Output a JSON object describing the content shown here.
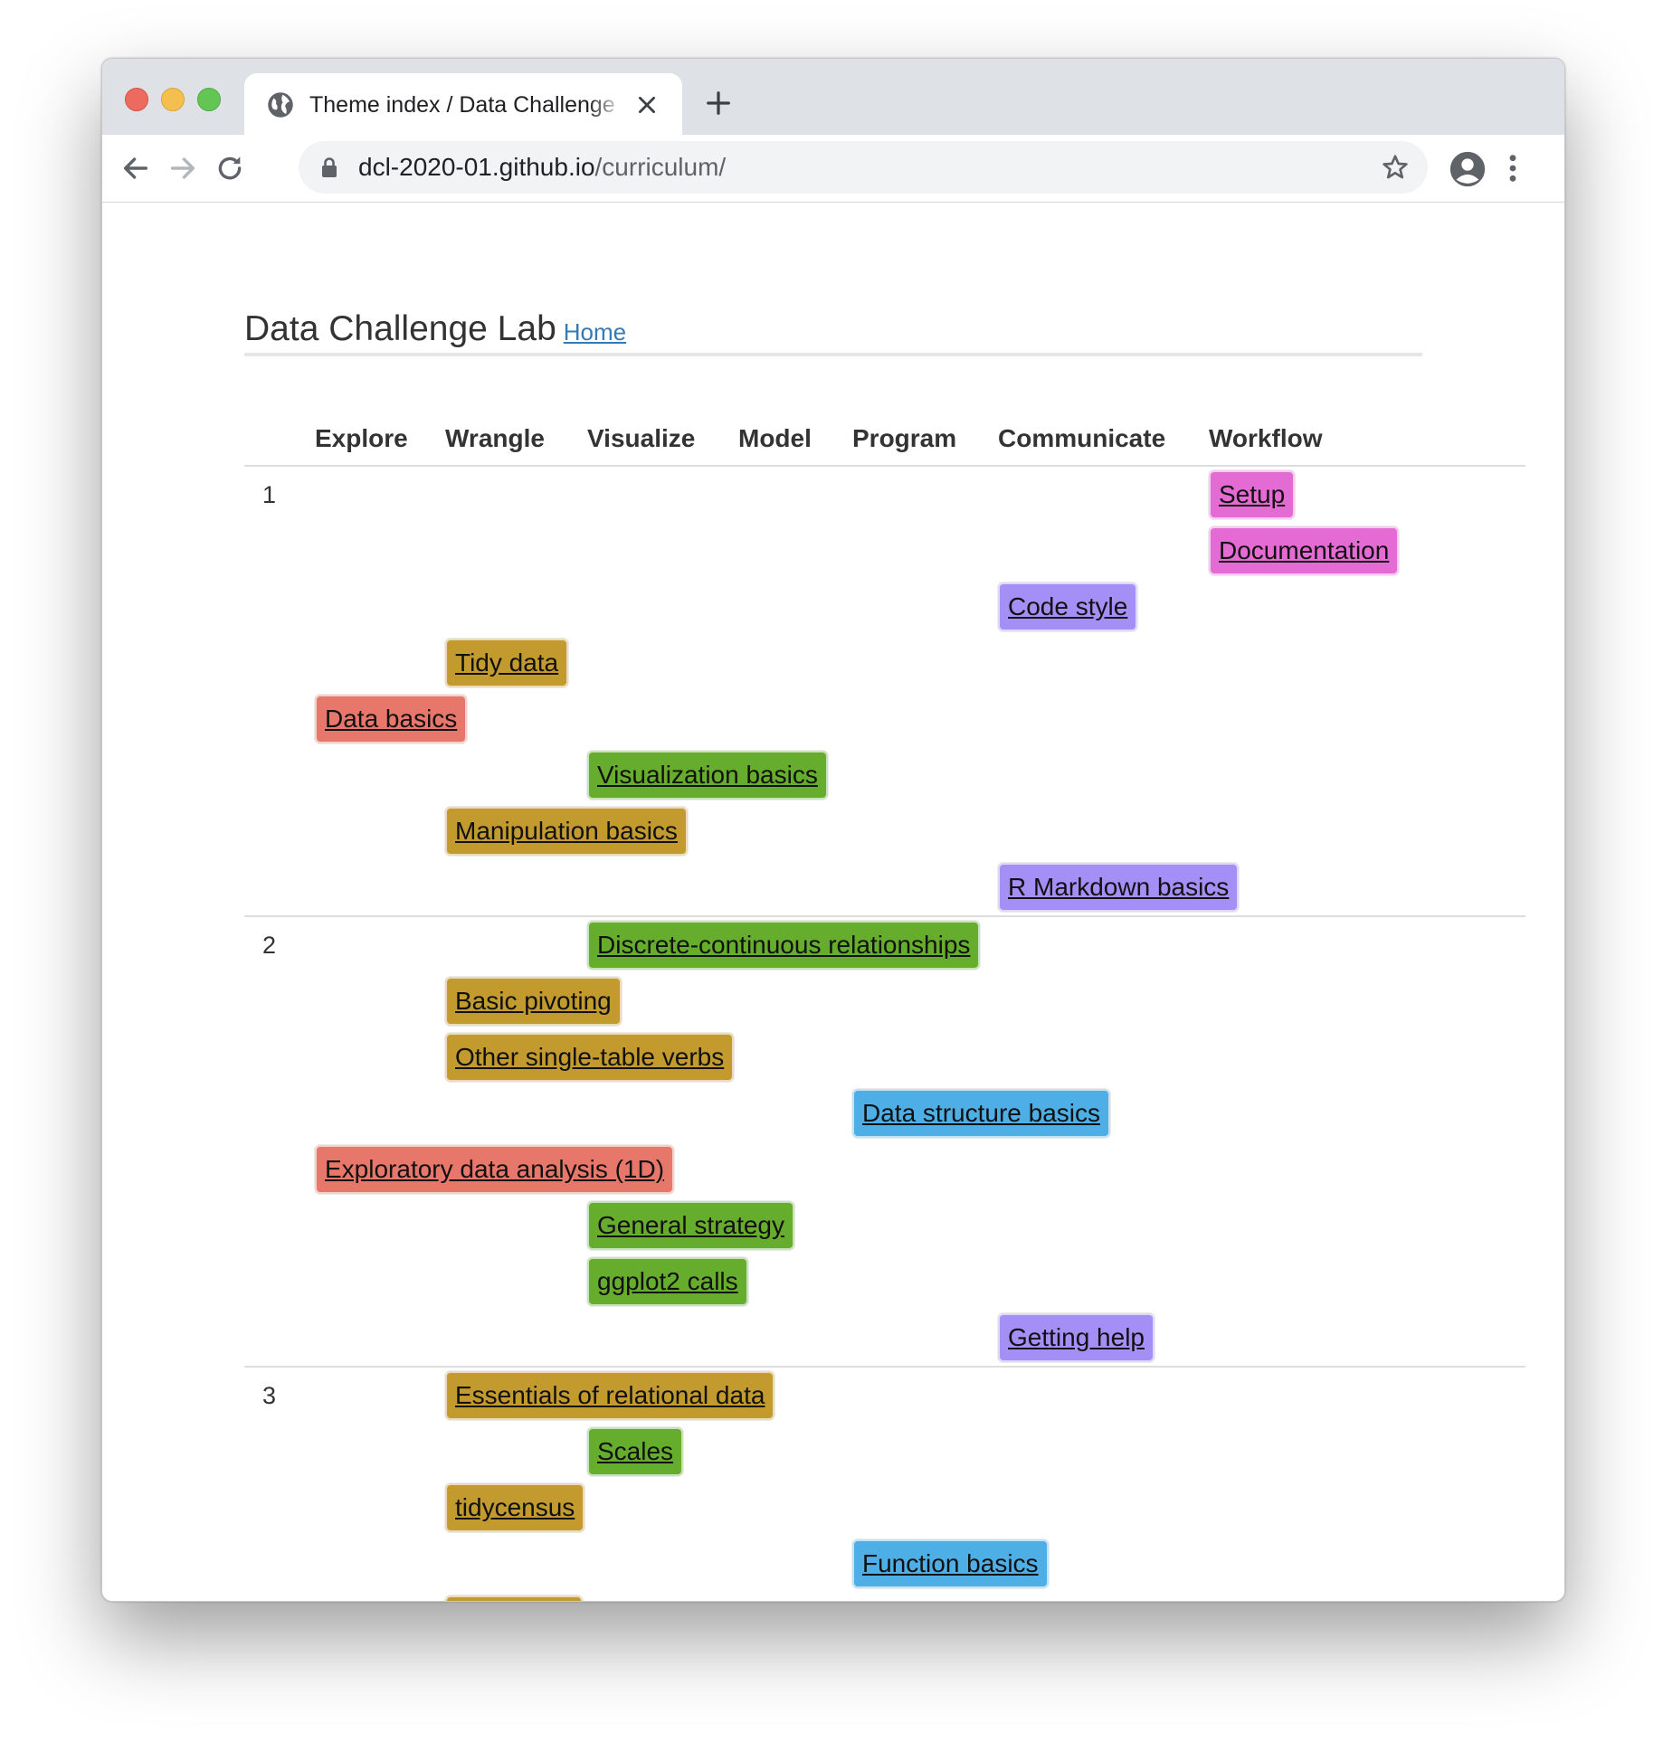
{
  "browser": {
    "tab_title": "Theme index / Data Challenge Lab",
    "url_host": "dcl-2020-01.github.io",
    "url_path": "/curriculum/"
  },
  "page": {
    "site_title": "Data Challenge Lab",
    "home_link": "Home"
  },
  "columns": [
    "Explore",
    "Wrangle",
    "Visualize",
    "Model",
    "Program",
    "Communicate",
    "Workflow"
  ],
  "colors": {
    "Explore": "#e8776b",
    "Wrangle": "#c29a2e",
    "Visualize": "#66ad2e",
    "Program": "#4eaee6",
    "Communicate": "#a38ff5",
    "Workflow": "#e56bd4"
  },
  "units": [
    {
      "number": "1",
      "topics": [
        {
          "label": "Setup",
          "column": "Workflow"
        },
        {
          "label": "Documentation",
          "column": "Workflow"
        },
        {
          "label": "Code style",
          "column": "Communicate"
        },
        {
          "label": "Tidy data",
          "column": "Wrangle"
        },
        {
          "label": "Data basics",
          "column": "Explore"
        },
        {
          "label": "Visualization basics",
          "column": "Visualize"
        },
        {
          "label": "Manipulation basics",
          "column": "Wrangle"
        },
        {
          "label": "R Markdown basics",
          "column": "Communicate"
        }
      ]
    },
    {
      "number": "2",
      "topics": [
        {
          "label": "Discrete-continuous relationships",
          "column": "Visualize"
        },
        {
          "label": "Basic pivoting",
          "column": "Wrangle"
        },
        {
          "label": "Other single-table verbs",
          "column": "Wrangle"
        },
        {
          "label": "Data structure basics",
          "column": "Program"
        },
        {
          "label": "Exploratory data analysis (1D)",
          "column": "Explore"
        },
        {
          "label": "General strategy",
          "column": "Visualize"
        },
        {
          "label": "ggplot2 calls",
          "column": "Visualize"
        },
        {
          "label": "Getting help",
          "column": "Communicate"
        }
      ]
    },
    {
      "number": "3",
      "topics": [
        {
          "label": "Essentials of relational data",
          "column": "Wrangle"
        },
        {
          "label": "Scales",
          "column": "Visualize"
        },
        {
          "label": "tidycensus",
          "column": "Wrangle"
        },
        {
          "label": "Function basics",
          "column": "Program"
        },
        {
          "label": "",
          "column": "Wrangle"
        }
      ]
    }
  ]
}
